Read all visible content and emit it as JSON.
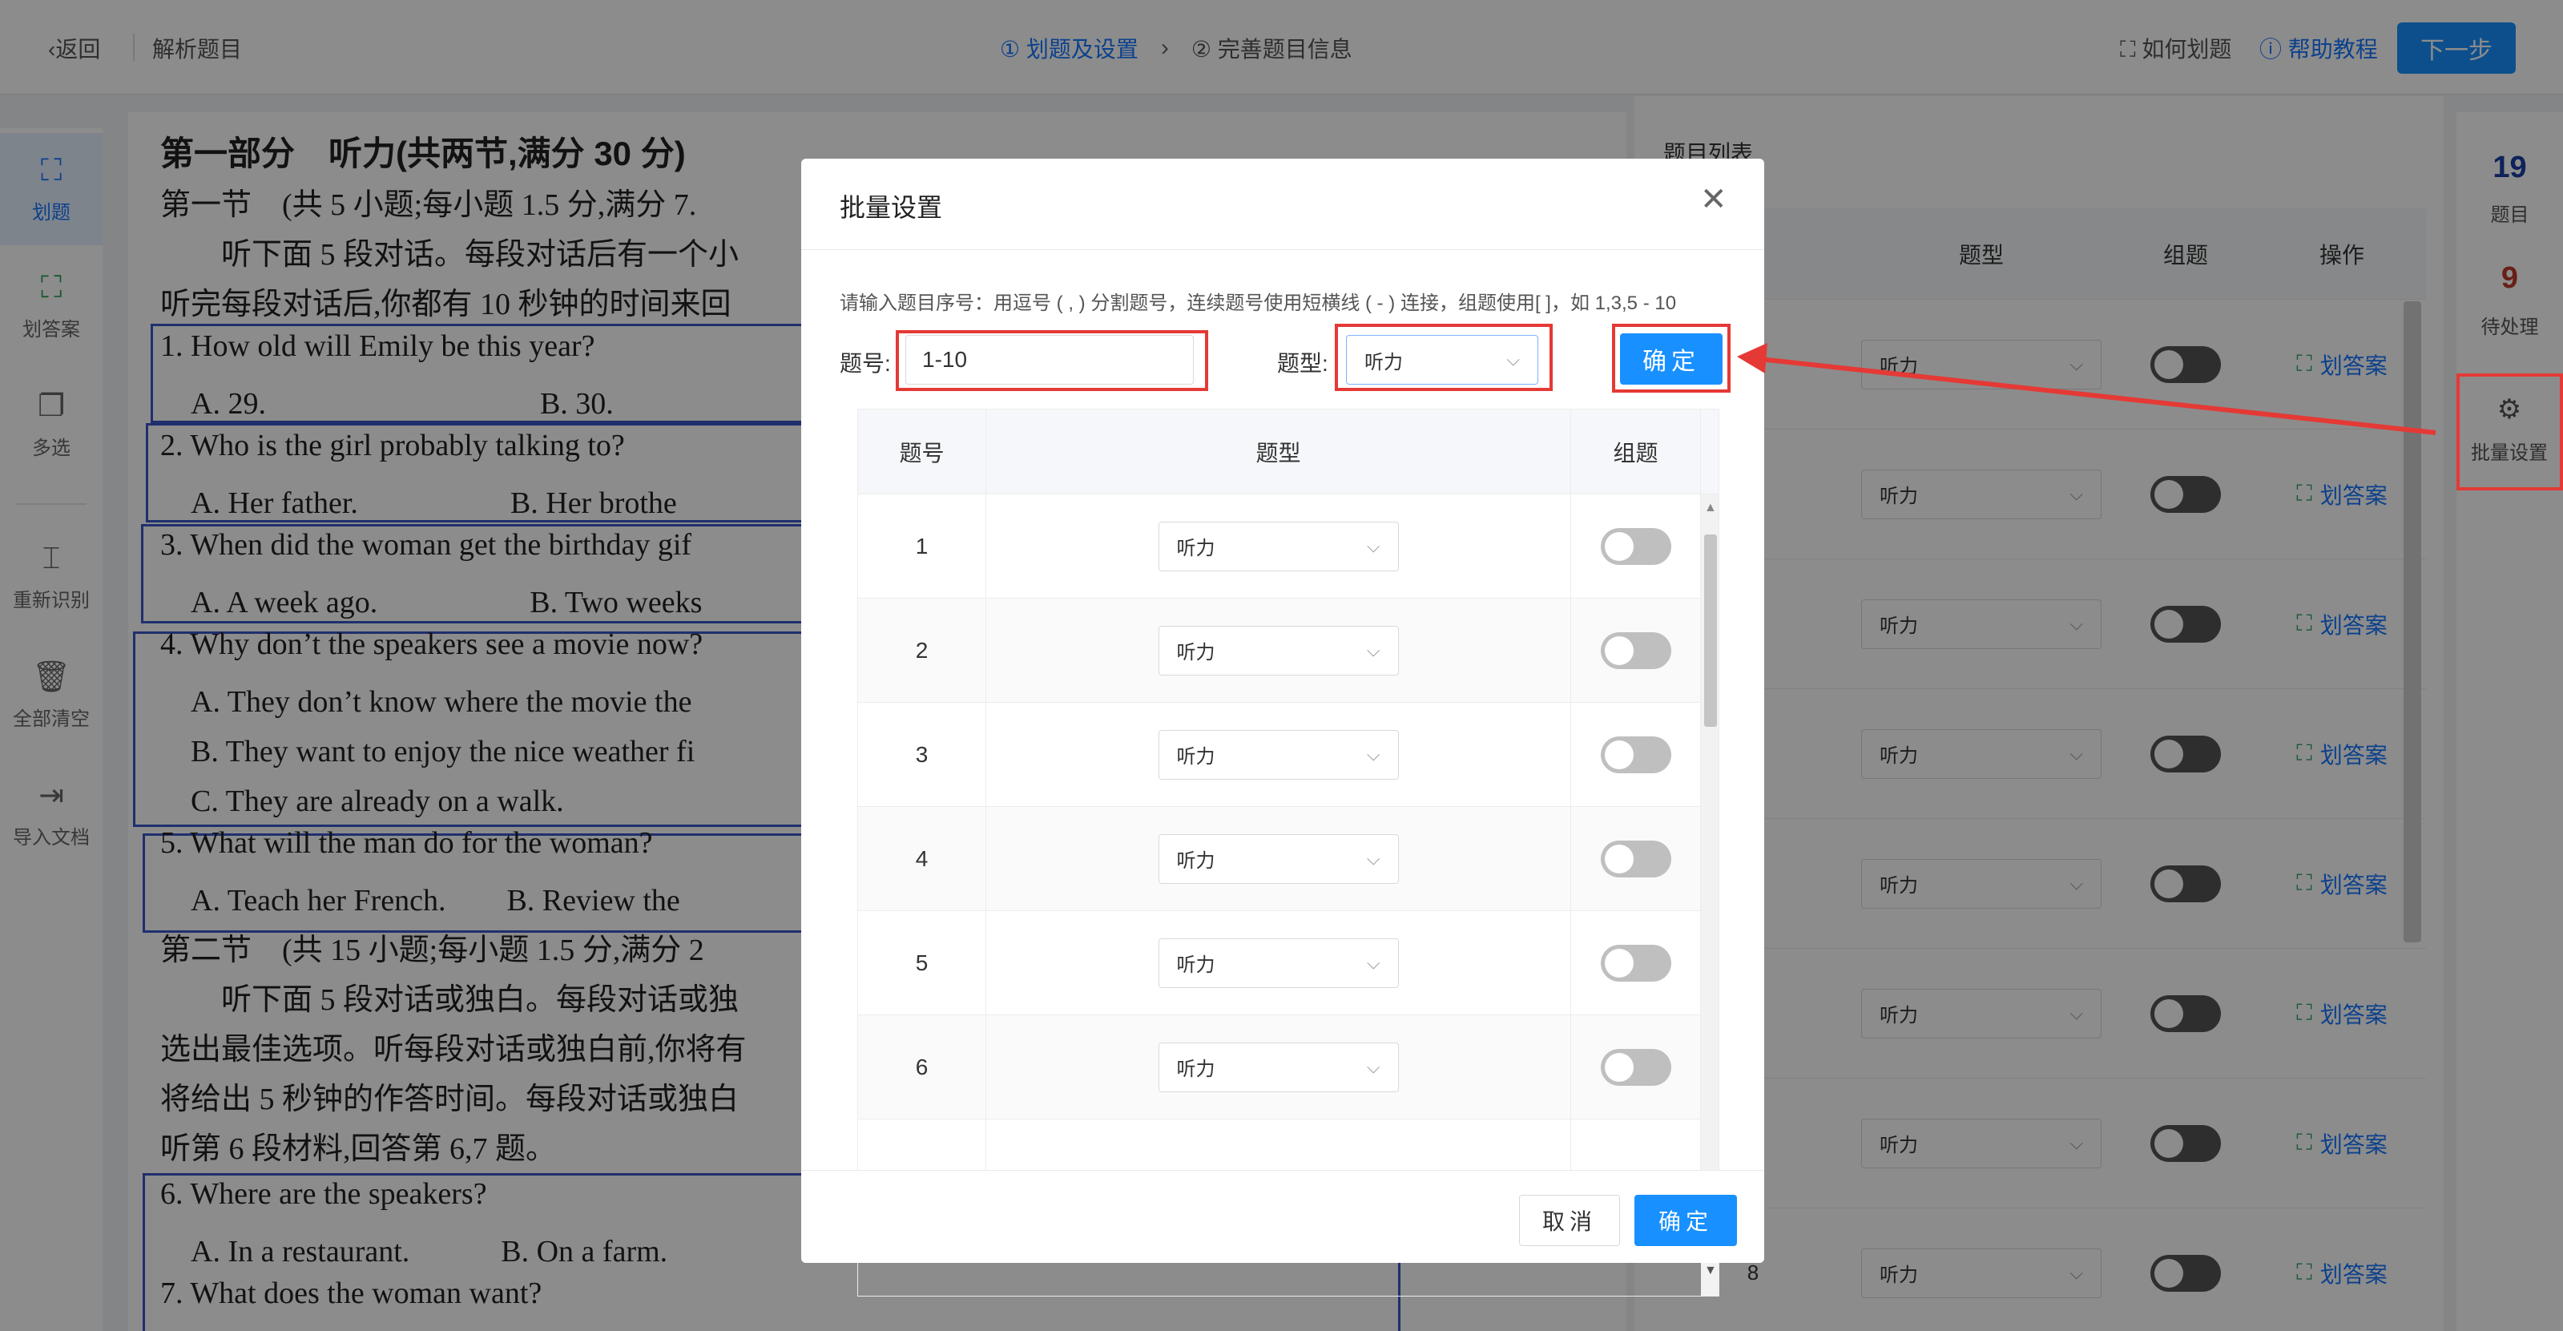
{
  "topbar": {
    "back": "返回",
    "page_title": "解析题目",
    "step1": "① 划题及设置",
    "step2": "② 完善题目信息",
    "how": "如何划题",
    "help": "帮助教程",
    "next": "下一步"
  },
  "left_tools": [
    {
      "label": "划题",
      "icon": "crop-icon"
    },
    {
      "label": "划答案",
      "icon": "crop-answer-icon"
    },
    {
      "label": "多选",
      "icon": "multi-select-icon"
    },
    {
      "label": "重新识别",
      "icon": "ocr-icon"
    },
    {
      "label": "全部清空",
      "icon": "trash-icon"
    },
    {
      "label": "导入文档",
      "icon": "import-icon"
    }
  ],
  "paper": {
    "lines": [
      "第一部分　听力(共两节,满分 30 分)",
      "第一节　(共 5 小题;每小题 1.5 分,满分 7.",
      "　　听下面 5 段对话。每段对话后有一个小",
      "听完每段对话后,你都有 10 秒钟的时间来回",
      "1. How old will Emily be this year?",
      "　A. 29.　　　　　　　　　B. 30.",
      "2. Who is the girl probably talking to?",
      "　A. Her father.　　　　　B. Her brothe",
      "3. When did the woman get the birthday gif",
      "　A. A week ago.　　　　　B. Two weeks",
      "4. Why don’t the speakers see a movie now?",
      "　A. They don’t know where the movie the",
      "　B. They want to enjoy the nice weather fi",
      "　C. They are already on a walk.",
      "5. What will the man do for the woman?",
      "　A. Teach her French.　　B. Review the",
      "第二节　(共 15 小题;每小题 1.5 分,满分 2",
      "　　听下面 5 段对话或独白。每段对话或独",
      "选出最佳选项。听每段对话或独白前,你将有",
      "将给出 5 秒钟的作答时间。每段对话或独白",
      "听第 6 段材料,回答第 6,7 题。",
      "6. Where are the speakers?",
      "　A. In a restaurant.　　　B. On a farm.",
      "7. What does the woman want?"
    ]
  },
  "right_panel": {
    "title": "题目列表",
    "headers": [
      "题型",
      "组题",
      "操作"
    ],
    "rows": [
      {
        "type": "听力",
        "op": "划答案"
      },
      {
        "type": "听力",
        "op": "划答案"
      },
      {
        "type": "听力",
        "op": "划答案"
      },
      {
        "type": "听力",
        "op": "划答案"
      },
      {
        "type": "听力",
        "op": "划答案"
      },
      {
        "type": "听力",
        "op": "划答案"
      },
      {
        "type": "听力",
        "op": "划答案"
      },
      {
        "num": "8",
        "type": "听力",
        "op": "划答案"
      }
    ]
  },
  "right_side": {
    "count_questions": "19",
    "label_questions": "题目",
    "count_pending": "9",
    "label_pending": "待处理",
    "batch": "批量设置"
  },
  "modal": {
    "title": "批量设置",
    "hint": "请输入题目序号：用逗号 ( , ) 分割题号，连续题号使用短横线 ( - ) 连接，组题使用[ ]，如 1,3,5 - 10",
    "num_label": "题号:",
    "num_value": "1-10",
    "type_label": "题型:",
    "type_value": "听力",
    "confirm_top": "确定",
    "table_headers": [
      "题号",
      "题型",
      "组题"
    ],
    "rows": [
      {
        "num": "1",
        "type": "听力"
      },
      {
        "num": "2",
        "type": "听力"
      },
      {
        "num": "3",
        "type": "听力"
      },
      {
        "num": "4",
        "type": "听力"
      },
      {
        "num": "5",
        "type": "听力"
      },
      {
        "num": "6",
        "type": "听力"
      }
    ],
    "cancel": "取消",
    "ok": "确定"
  },
  "colors": {
    "primary": "#1890ff",
    "annotation_red": "#e53935",
    "question_box": "#3a56c8"
  }
}
